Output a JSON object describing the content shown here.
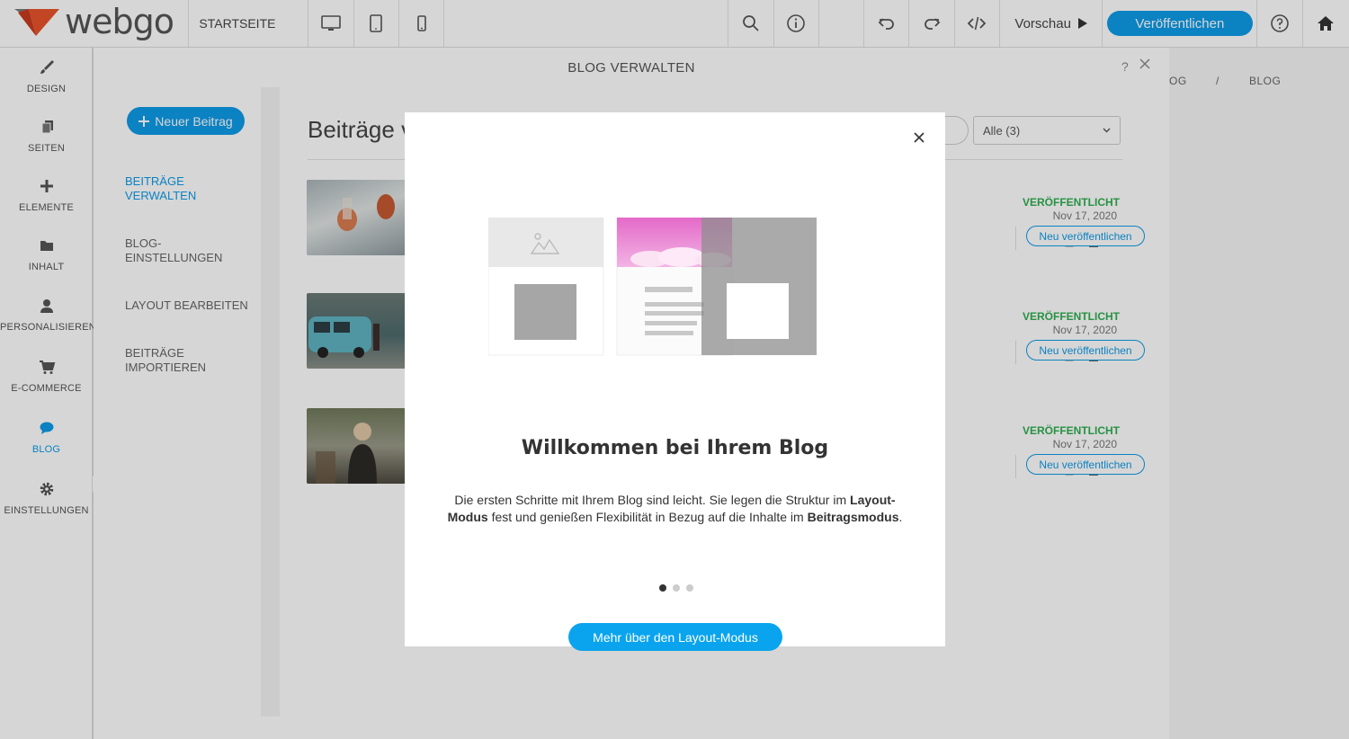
{
  "brand": {
    "name": "webgo"
  },
  "toolbar": {
    "page_label": "STARTSEITE",
    "preview_label": "Vorschau",
    "publish_label": "Veröffentlichen"
  },
  "leftnav": {
    "items": [
      {
        "label": "DESIGN",
        "icon": "brush-icon"
      },
      {
        "label": "SEITEN",
        "icon": "pages-icon"
      },
      {
        "label": "ELEMENTE",
        "icon": "plus-icon"
      },
      {
        "label": "INHALT",
        "icon": "folder-icon"
      },
      {
        "label": "PERSONALISIEREN",
        "icon": "user-icon"
      },
      {
        "label": "E-COMMERCE",
        "icon": "cart-icon"
      },
      {
        "label": "BLOG",
        "icon": "chat-bubble-icon"
      },
      {
        "label": "EINSTELLUNGEN",
        "icon": "gear-icon"
      }
    ]
  },
  "panel": {
    "title": "BLOG VERWALTEN",
    "help": "?",
    "new_post_label": "Neuer Beitrag",
    "sub_nav": [
      {
        "line1": "BEITRÄGE",
        "line2": "VERWALTEN"
      },
      {
        "line1": "BLOG-",
        "line2": "EINSTELLUNGEN"
      },
      {
        "line1": "LAYOUT BEARBEITEN",
        "line2": ""
      },
      {
        "line1": "BEITRÄGE",
        "line2": "IMPORTIEREN"
      }
    ],
    "content_title": "Beiträge v",
    "filter_value": "Alle (3)",
    "posts": [
      {
        "status": "VERÖFFENTLICHT",
        "date": "Nov 17, 2020",
        "action": "Neu veröffentlichen"
      },
      {
        "status": "VERÖFFENTLICHT",
        "date": "Nov 17, 2020",
        "action": "Neu veröffentlichen"
      },
      {
        "status": "VERÖFFENTLICHT",
        "date": "Nov 17, 2020",
        "action": "Neu veröffentlichen"
      }
    ]
  },
  "breadcrumb": {
    "part1": "OG",
    "sep": "/",
    "part2": "BLOG"
  },
  "modal": {
    "title": "Willkommen bei Ihrem Blog",
    "text_1": "Die ersten Schritte mit Ihrem Blog sind leicht. Sie legen die Struktur im ",
    "text_bold_1": "Layout-Modus",
    "text_2": " fest und genießen Flexibilität in Bezug auf die Inhalte im ",
    "text_bold_2": "Beitragsmodus",
    "text_3": ".",
    "slides_total": 3,
    "slide_active": 1,
    "cta_label": "Mehr über den Layout-Modus"
  },
  "colors": {
    "accent": "#0e9be8",
    "published": "#2eae4f",
    "logo_orange": "#e8542c"
  }
}
